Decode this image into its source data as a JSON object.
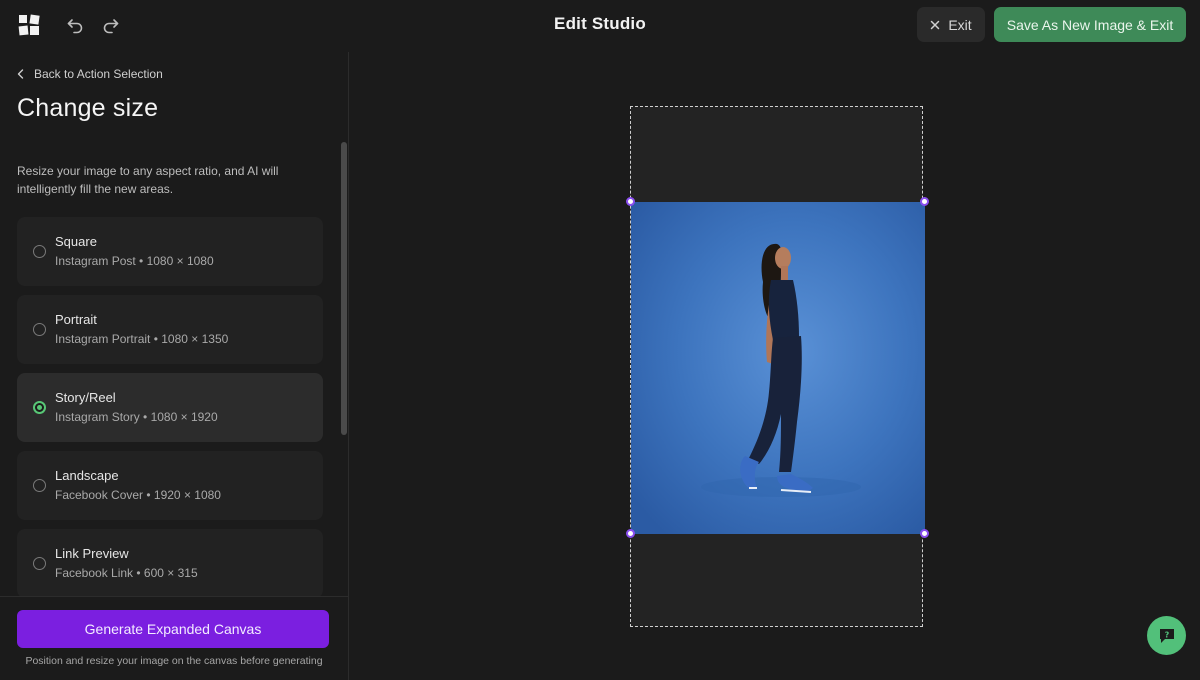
{
  "header": {
    "title": "Edit Studio",
    "exit_label": "Exit",
    "save_label": "Save As New Image & Exit"
  },
  "sidebar": {
    "back_label": "Back to Action Selection",
    "title": "Change size",
    "description": "Resize your image to any aspect ratio, and AI will intelligently fill the new areas.",
    "options": [
      {
        "name": "Square",
        "sub": "Instagram Post • 1080 × 1080",
        "selected": false
      },
      {
        "name": "Portrait",
        "sub": "Instagram Portrait • 1080 × 1350",
        "selected": false
      },
      {
        "name": "Story/Reel",
        "sub": "Instagram Story • 1080 × 1920",
        "selected": true
      },
      {
        "name": "Landscape",
        "sub": "Facebook Cover • 1920 × 1080",
        "selected": false
      },
      {
        "name": "Link Preview",
        "sub": "Facebook Link • 600 × 315",
        "selected": false
      }
    ],
    "generate_label": "Generate Expanded Canvas",
    "hint": "Position and resize your image on the canvas before generating"
  },
  "colors": {
    "background": "#1b1b1b",
    "accent_purple": "#7b1fe0",
    "save_green": "#3e8a58",
    "selected_radio": "#58c776",
    "photo_blue": "#3b72bd"
  },
  "icons": [
    "app-logo-icon",
    "undo-icon",
    "redo-icon",
    "close-icon",
    "chevron-left-icon",
    "feedback-icon"
  ]
}
